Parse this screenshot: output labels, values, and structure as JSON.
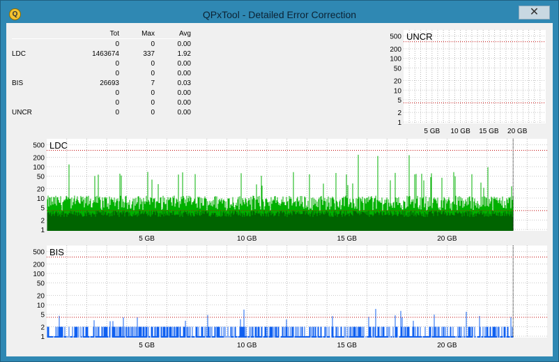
{
  "window": {
    "title": "QPxTool - Detailed Error Correction",
    "close_glyph": "✕",
    "app_icon": "Q"
  },
  "stats": {
    "headers": [
      "",
      "Tot",
      "Max",
      "Avg"
    ],
    "rows": [
      [
        "",
        "0",
        "0",
        "0.00"
      ],
      [
        "LDC",
        "1463674",
        "337",
        "1.92"
      ],
      [
        "",
        "0",
        "0",
        "0.00"
      ],
      [
        "",
        "0",
        "0",
        "0.00"
      ],
      [
        "BIS",
        "26693",
        "7",
        "0.03"
      ],
      [
        "",
        "0",
        "0",
        "0.00"
      ],
      [
        "",
        "0",
        "0",
        "0.00"
      ],
      [
        "UNCR",
        "0",
        "0",
        "0.00"
      ]
    ]
  },
  "chart_data": [
    {
      "type": "bar",
      "title": "UNCR",
      "yscale": "log",
      "y_ticks": [
        "500",
        "200",
        "100",
        "50",
        "20",
        "10",
        "5",
        "2",
        "1"
      ],
      "x_ticks": [
        "5 GB",
        "10 GB",
        "15 GB",
        "20 GB"
      ],
      "xlim": [
        0,
        25
      ],
      "values": [],
      "color": "#f00000",
      "thresholds": [
        333,
        4
      ]
    },
    {
      "type": "bar",
      "title": "LDC",
      "yscale": "log",
      "y_ticks": [
        "500",
        "200",
        "100",
        "50",
        "20",
        "10",
        "5",
        "2",
        "1"
      ],
      "x_ticks": [
        "5 GB",
        "10 GB",
        "15 GB",
        "20 GB"
      ],
      "xlim": [
        0,
        25
      ],
      "end_gb": 23.3,
      "color": "#00b000",
      "color_dark": "#006400",
      "max": 337,
      "avg": 1.92,
      "thresholds": [
        333,
        4
      ]
    },
    {
      "type": "bar",
      "title": "BIS",
      "yscale": "log",
      "y_ticks": [
        "500",
        "200",
        "100",
        "50",
        "20",
        "10",
        "5",
        "2",
        "1"
      ],
      "x_ticks": [
        "5 GB",
        "10 GB",
        "15 GB",
        "20 GB"
      ],
      "xlim": [
        0,
        25
      ],
      "end_gb": 23.3,
      "color": "#1060f0",
      "max": 7,
      "avg": 0.03,
      "thresholds": [
        333,
        4
      ]
    }
  ]
}
